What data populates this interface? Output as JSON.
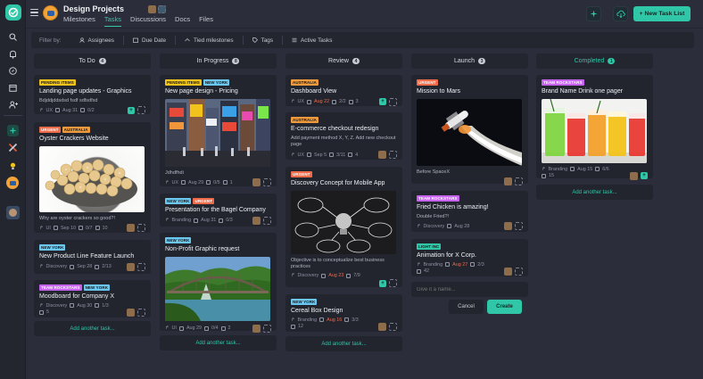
{
  "project": {
    "title": "Design Projects"
  },
  "tabs": [
    {
      "label": "Milestones"
    },
    {
      "label": "Tasks"
    },
    {
      "label": "Discussions"
    },
    {
      "label": "Docs"
    },
    {
      "label": "Files"
    }
  ],
  "header": {
    "new_list_label": "+ New Task List"
  },
  "filters": {
    "label": "Filter by:",
    "items": [
      {
        "label": "Assignees",
        "icon": "users-icon"
      },
      {
        "label": "Due Date",
        "icon": "calendar-icon"
      },
      {
        "label": "Tied milestones",
        "icon": "milestone-icon"
      },
      {
        "label": "Tags",
        "icon": "tag-icon"
      },
      {
        "label": "Active Tasks",
        "icon": "list-icon"
      }
    ]
  },
  "columns": [
    {
      "title": "To Do",
      "count": "4",
      "add_label": "Add another task...",
      "cards": [
        {
          "tags": [
            "PENDING ITEMS"
          ],
          "title": "Landing page updates - Graphics",
          "desc": "Bdjddjddsdsd fsdf sdfsdfsd",
          "meta": {
            "milestone": "UX",
            "due": "Aug 31",
            "checks": "0/2"
          }
        },
        {
          "tags": [
            "URGENT",
            "AUSTRALIA"
          ],
          "title": "Oyster Crackers Website",
          "desc": "Why are oyster crackers so good?!",
          "meta": {
            "milestone": "UI",
            "due": "Sep 10",
            "checks": "0/7",
            "comments": "10"
          }
        },
        {
          "tags": [
            "NEW YORK"
          ],
          "title": "New Product Line Feature Launch",
          "meta": {
            "milestone": "Discovery",
            "due": "Sep 28",
            "checks": "2/13"
          }
        },
        {
          "tags": [
            "TEAM ROCKSTARS",
            "NEW YORK"
          ],
          "title": "Moodboard for Company X",
          "meta": {
            "milestone": "Discovery",
            "due": "Aug 30",
            "checks": "1/3",
            "comments": "5"
          }
        }
      ]
    },
    {
      "title": "In Progress",
      "count": "8",
      "add_label": "Add another task...",
      "cards": [
        {
          "tags": [
            "PENDING ITEMS",
            "NEW YORK"
          ],
          "title": "New page design - Pricing",
          "desc": "Jdhdfhdi",
          "meta": {
            "milestone": "UX",
            "due": "Aug 29",
            "checks": "0/5",
            "comments": "1"
          }
        },
        {
          "tags": [
            "NEW YORK",
            "URGENT"
          ],
          "title": "Presentation for the Bagel Company",
          "meta": {
            "milestone": "Branding",
            "due": "Aug 31",
            "checks": "0/3"
          }
        },
        {
          "tags": [
            "NEW YORK"
          ],
          "title": "Non-Profit Graphic request",
          "meta": {
            "milestone": "UI",
            "due": "Aug 29",
            "checks": "0/4",
            "comments": "2"
          }
        }
      ]
    },
    {
      "title": "Review",
      "count": "4",
      "add_label": "Add another task...",
      "cards": [
        {
          "tags": [
            "AUSTRALIA"
          ],
          "title": "Dashboard View",
          "meta": {
            "milestone": "UX",
            "due": "Aug 22",
            "checks": "2/2",
            "comments": "3"
          }
        },
        {
          "tags": [
            "AUSTRALIA"
          ],
          "title": "E-commerce checkout redesign",
          "desc": "Add payment method X, Y, Z. Add new checkout page",
          "meta": {
            "milestone": "UX",
            "due": "Sep 5",
            "checks": "3/11",
            "comments": "4"
          }
        },
        {
          "tags": [
            "URGENT"
          ],
          "title": "Discovery Concept for Mobile App",
          "desc": "Objective is to conceptualize best business practices",
          "meta": {
            "milestone": "Discovery",
            "due": "Aug 23",
            "checks": "7/9"
          }
        },
        {
          "tags": [
            "NEW YORK"
          ],
          "title": "Cereal Box Design",
          "meta": {
            "milestone": "Branding",
            "due": "Aug 16",
            "checks": "3/3",
            "comments": "12"
          }
        }
      ]
    },
    {
      "title": "Launch",
      "count": "3",
      "cards": [
        {
          "tags": [
            "URGENT"
          ],
          "title": "Mission to Mars",
          "desc": "Before SpaceX",
          "meta": {}
        },
        {
          "tags": [
            "TEAM ROCKSTARS"
          ],
          "title": "Fried Chicken is amazing!",
          "desc": "Double Fried?!",
          "meta": {
            "milestone": "Discovery",
            "due": "Aug 28"
          }
        },
        {
          "tags": [
            "LIGHT INC"
          ],
          "title": "Animation for X Corp.",
          "meta": {
            "milestone": "Branding",
            "due": "Aug 27",
            "checks": "2/3",
            "comments": "42"
          }
        }
      ],
      "new_card_placeholder": "Give it a name...",
      "cancel_label": "Cancel",
      "create_label": "Create"
    },
    {
      "title": "Completed",
      "count": "1",
      "add_label": "Add another task...",
      "cards": [
        {
          "tags": [
            "TEAM ROCKSTARS"
          ],
          "title": "Brand Name Drink one pager",
          "meta": {
            "milestone": "Branding",
            "due": "Aug 15",
            "checks": "6/6",
            "comments": "15"
          }
        }
      ]
    }
  ]
}
